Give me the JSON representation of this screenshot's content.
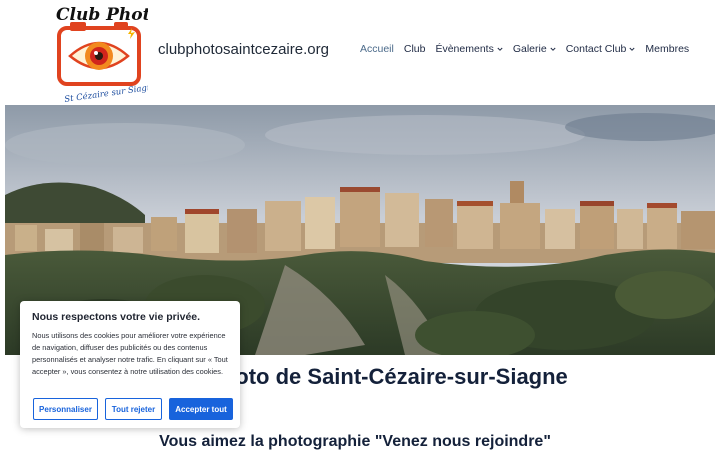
{
  "header": {
    "logo_text_top": "Club Photo",
    "logo_text_bottom": "St Cézaire sur Siagne",
    "site_title": "clubphotosaintcezaire.org"
  },
  "nav": {
    "items": [
      {
        "label": "Accueil",
        "active": true,
        "dropdown": false
      },
      {
        "label": "Club",
        "active": false,
        "dropdown": false
      },
      {
        "label": "Évènements",
        "active": false,
        "dropdown": true
      },
      {
        "label": "Galerie",
        "active": false,
        "dropdown": true
      },
      {
        "label": "Contact Club",
        "active": false,
        "dropdown": true
      },
      {
        "label": "Membres",
        "active": false,
        "dropdown": false
      }
    ]
  },
  "hero": {
    "icon": "village-panorama-image"
  },
  "main": {
    "heading": "Club Photo de Saint-Cézaire-sur-Siagne",
    "subheading": "Vous aimez la photographie \"Venez nous rejoindre\""
  },
  "cookie": {
    "title": "Nous respectons votre vie privée.",
    "text": "Nous utilisons des cookies pour améliorer votre expérience de navigation, diffuser des publicités ou des contenus personnalisés et analyser notre trafic. En cliquant sur « Tout accepter », vous consentez à notre utilisation des cookies.",
    "btn_customize": "Personnaliser",
    "btn_reject": "Tout rejeter",
    "btn_accept": "Accepter tout"
  },
  "colors": {
    "accent": "#1863dc",
    "nav_active": "#4b6a8a",
    "text_dark": "#14213a"
  }
}
